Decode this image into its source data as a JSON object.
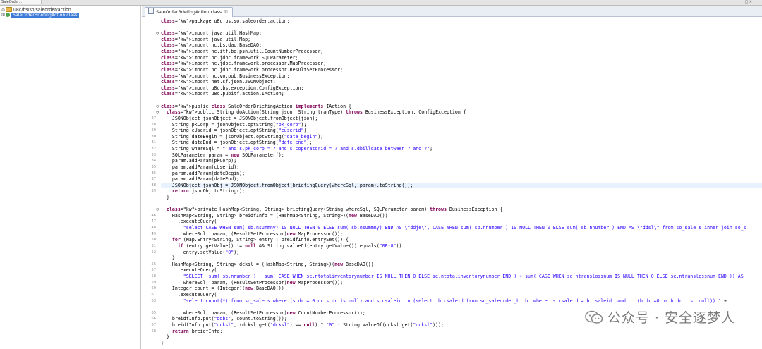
{
  "window": {
    "top_tab_label": "SaleOrder...",
    "top_buttons": "□ ✕"
  },
  "navigator": {
    "items": [
      {
        "label": "u8c/bs/so/saleorder/action",
        "icon": "folder-icon"
      },
      {
        "label": "SaleOrderBriefingAction.class",
        "icon": "class-file-icon",
        "selected": true
      }
    ]
  },
  "editor": {
    "tab_label": "SaleOrderBriefingAction.class",
    "close_glyph": "☒",
    "lines": [
      {
        "ln": "",
        "fold": "",
        "text": "package u8c.bs.so.saleorder.action;",
        "kind": "pkg"
      },
      {
        "ln": "",
        "fold": "",
        "text": "",
        "kind": "blank"
      },
      {
        "ln": "",
        "fold": "⊖",
        "text": "import java.util.HashMap;",
        "kind": "import"
      },
      {
        "ln": "",
        "fold": "",
        "text": "import java.util.Map;",
        "kind": "import"
      },
      {
        "ln": "",
        "fold": "",
        "text": "import nc.bs.dao.BaseDAO;",
        "kind": "import"
      },
      {
        "ln": "",
        "fold": "",
        "text": "import nc.itf.bd.psn.util.CountNumberProcessor;",
        "kind": "import"
      },
      {
        "ln": "",
        "fold": "",
        "text": "import nc.jdbc.framework.SQLParameter;",
        "kind": "import"
      },
      {
        "ln": "",
        "fold": "",
        "text": "import nc.jdbc.framework.processor.MapProcessor;",
        "kind": "import"
      },
      {
        "ln": "",
        "fold": "",
        "text": "import nc.jdbc.framework.processor.ResultSetProcessor;",
        "kind": "import"
      },
      {
        "ln": "",
        "fold": "",
        "text": "import nc.vo.pub.BusinessException;",
        "kind": "import"
      },
      {
        "ln": "",
        "fold": "",
        "text": "import net.sf.json.JSONObject;",
        "kind": "import"
      },
      {
        "ln": "",
        "fold": "",
        "text": "import u8c.bs.exception.ConfigException;",
        "kind": "import"
      },
      {
        "ln": "",
        "fold": "",
        "text": "import u8c.pubitf.action.IAction;",
        "kind": "import"
      },
      {
        "ln": "",
        "fold": "",
        "text": "",
        "kind": "blank"
      },
      {
        "ln": "",
        "fold": "⊖",
        "text": "public class SaleOrderBriefingAction implements IAction {",
        "kind": "code"
      },
      {
        "ln": "",
        "fold": "⊖",
        "text": "  public String doAction(String json, String tranType) throws BusinessException, ConfigException {",
        "kind": "code"
      },
      {
        "ln": "27",
        "fold": "",
        "text": "    JSONObject jsonObject = JSONObject.fromObject(json);",
        "kind": "code"
      },
      {
        "ln": "28",
        "fold": "",
        "text": "    String pkCorp = jsonObject.optString(\"pk_corp\");",
        "kind": "code"
      },
      {
        "ln": "29",
        "fold": "",
        "text": "    String cUserid = jsonObject.optString(\"cuserid\");",
        "kind": "code"
      },
      {
        "ln": "30",
        "fold": "",
        "text": "    String dateBegin = jsonObject.optString(\"date_begin\");",
        "kind": "code"
      },
      {
        "ln": "31",
        "fold": "",
        "text": "    String dateEnd = jsonObject.optString(\"date_end\");",
        "kind": "code"
      },
      {
        "ln": "32",
        "fold": "",
        "text": "    String whereSql = \" and s.pk_corp = ? and s.coperatorid = ? and s.dbilldate between ? and ?\";",
        "kind": "code"
      },
      {
        "ln": "33",
        "fold": "",
        "text": "    SQLParameter param = new SQLParameter();",
        "kind": "code"
      },
      {
        "ln": "34",
        "fold": "",
        "text": "    param.addParam(pkCorp);",
        "kind": "code"
      },
      {
        "ln": "35",
        "fold": "",
        "text": "    param.addParam(cUserid);",
        "kind": "code"
      },
      {
        "ln": "36",
        "fold": "",
        "text": "    param.addParam(dateBegin);",
        "kind": "code"
      },
      {
        "ln": "37",
        "fold": "",
        "text": "    param.addParam(dateEnd);",
        "kind": "code"
      },
      {
        "ln": "38",
        "fold": "",
        "text": "    JSONObject jsonObj = JSONObject.fromObject(briefingQuery(whereSql, param).toString());",
        "kind": "code",
        "highlight": true
      },
      {
        "ln": "39",
        "fold": "",
        "text": "    return jsonObj.toString();",
        "kind": "code"
      },
      {
        "ln": "",
        "fold": "",
        "text": "  }",
        "kind": "code"
      },
      {
        "ln": "",
        "fold": "",
        "text": "",
        "kind": "blank"
      },
      {
        "ln": "",
        "fold": "⊖",
        "text": "  private HashMap<String, String> briefingQuery(String whereSql, SQLParameter param) throws BusinessException {",
        "kind": "code"
      },
      {
        "ln": "46",
        "fold": "",
        "text": "    HashMap<String, String> breidfInfo = (HashMap<String, String>)(new BaseDAO())",
        "kind": "code"
      },
      {
        "ln": "47",
        "fold": "",
        "text": "      .executeQuery(",
        "kind": "code"
      },
      {
        "ln": "48",
        "fold": "",
        "text": "        \"select CASE WHEN sum( sb.nsummny) IS NULL THEN 0 ELSE sum( sb.nsummny) END AS \\\"ddje\\\", CASE WHEN sum( sb.nnumber ) IS NULL THEN 0 ELSE sum( sb.nnumber ) END AS \\\"ddsl\\\" from so_sale s inner join so_s",
        "kind": "code"
      },
      {
        "ln": "49",
        "fold": "",
        "text": "        whereSql, param, (ResultSetProcessor)new MapProcessor());",
        "kind": "code"
      },
      {
        "ln": "50",
        "fold": "",
        "text": "    for (Map.Entry<String, String> entry : breidfInfo.entrySet()) {",
        "kind": "code"
      },
      {
        "ln": "51",
        "fold": "",
        "text": "      if (entry.getValue() != null && String.valueOf(entry.getValue()).equals(\"0E-8\"))",
        "kind": "code"
      },
      {
        "ln": "52",
        "fold": "",
        "text": "        entry.setValue(\"0\");",
        "kind": "code"
      },
      {
        "ln": "",
        "fold": "",
        "text": "    }",
        "kind": "code"
      },
      {
        "ln": "56",
        "fold": "",
        "text": "    HashMap<String, String> dcksl = (HashMap<String, String>)(new BaseDAO())",
        "kind": "code"
      },
      {
        "ln": "57",
        "fold": "",
        "text": "      .executeQuery(",
        "kind": "code"
      },
      {
        "ln": "58",
        "fold": "",
        "text": "        \"SELECT (sum( sb.nnumber ) - sum( CASE WHEN se.ntotalinventorynumber IS NULL THEN 0 ELSE se.ntotalinventorynumber END ) + sum( CASE WHEN se.ntranslossnum IS NULL THEN 0 ELSE se.ntranslossnum END )) AS",
        "kind": "code"
      },
      {
        "ln": "59",
        "fold": "",
        "text": "        whereSql, param, (ResultSetProcessor)new MapProcessor());",
        "kind": "code"
      },
      {
        "ln": "60",
        "fold": "",
        "text": "    Integer count = (Integer)(new BaseDAO())",
        "kind": "code"
      },
      {
        "ln": "61",
        "fold": "",
        "text": "      .executeQuery(",
        "kind": "code"
      },
      {
        "ln": "63",
        "fold": "",
        "text": "        \"select count(*) from so_sale s where (s.dr = 0 or s.dr is null) and s.csaleid in (select  b.csaleid from so_saleorder_b  b  where  s.csaleid = b.csaleid  and    (b.dr =0 or b.dr  is  null)) \" +",
        "kind": "code"
      },
      {
        "ln": "",
        "fold": "",
        "text": "",
        "kind": "blank"
      },
      {
        "ln": "65",
        "fold": "",
        "text": "        whereSql, param, (ResultSetProcessor)new CountNumberProcessor());",
        "kind": "code"
      },
      {
        "ln": "66",
        "fold": "",
        "text": "    breidfInfo.put(\"ddbs\", count.toString());",
        "kind": "code"
      },
      {
        "ln": "67",
        "fold": "",
        "text": "    breidfInfo.put(\"dcksl\", (dcksl.get(\"dcksl\") == null) ? \"0\" : String.valueOf(dcksl.get(\"dcksl\")));",
        "kind": "code"
      },
      {
        "ln": "68",
        "fold": "",
        "text": "    return breidfInfo;",
        "kind": "code"
      },
      {
        "ln": "",
        "fold": "",
        "text": "  }",
        "kind": "code"
      },
      {
        "ln": "",
        "fold": "",
        "text": "}",
        "kind": "code"
      }
    ]
  },
  "watermark": {
    "text": "公众号 · 安全逐梦人",
    "icon": "wechat-icon"
  },
  "colors": {
    "keyword": "#7f0055",
    "string": "#2a00ff",
    "selection": "#3d79d6",
    "current_line": "#e8f2fe"
  }
}
